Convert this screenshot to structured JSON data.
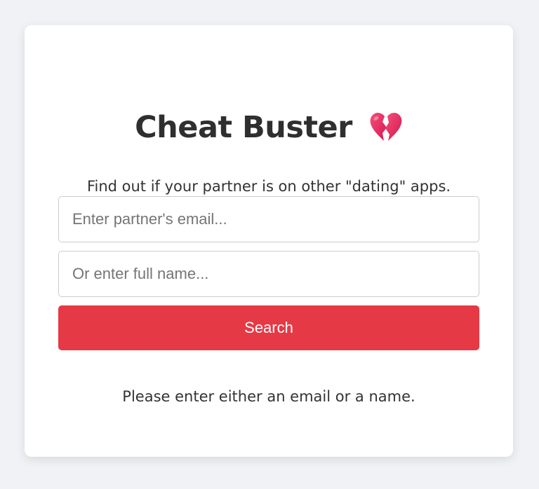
{
  "app": {
    "title": "Cheat Buster",
    "title_icon": "broken-heart-icon",
    "subtitle": "Find out if your partner is on other \"dating\" apps."
  },
  "form": {
    "email_placeholder": "Enter partner's email...",
    "email_value": "",
    "name_placeholder": "Or enter full name...",
    "name_value": "",
    "search_label": "Search"
  },
  "status": {
    "message": "Please enter either an email or a name."
  },
  "colors": {
    "page_background": "#f0f2f5",
    "card_background": "#ffffff",
    "accent": "#e63946",
    "text": "#333333",
    "heart": "#e8245e"
  }
}
